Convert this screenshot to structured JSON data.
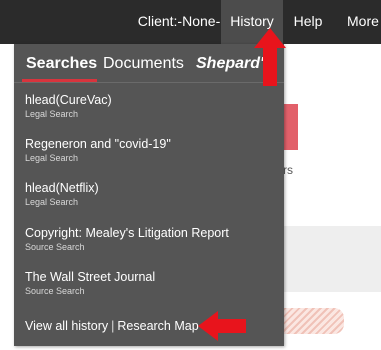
{
  "topnav": {
    "client_label": "Client:-None-",
    "history_label": "History",
    "help_label": "Help",
    "more_label": "More"
  },
  "background": {
    "partial_text": "rs"
  },
  "history_menu": {
    "tabs": [
      {
        "label": "Searches",
        "active": true
      },
      {
        "label": "Documents",
        "active": false
      },
      {
        "label": "Shepard's",
        "active": false
      }
    ],
    "items": [
      {
        "title": "hlead(CureVac)",
        "subtitle": "Legal Search"
      },
      {
        "title": "Regeneron and \"covid-19\"",
        "subtitle": "Legal Search"
      },
      {
        "title": "hlead(Netflix)",
        "subtitle": "Legal Search"
      },
      {
        "title": "Copyright: Mealey's Litigation Report",
        "subtitle": "Source Search"
      },
      {
        "title": "The Wall Street Journal",
        "subtitle": "Source Search"
      }
    ],
    "footer": {
      "view_all": "View all history",
      "separator": "|",
      "research_map": "Research Map"
    }
  },
  "colors": {
    "nav_bg": "#2b2b2b",
    "nav_active_bg": "#4c4c4c",
    "panel_bg": "#555555",
    "tab_underline": "#d8343d",
    "annotation_arrow": "#e8141c"
  },
  "icons": [
    "up-arrow-annotation-icon",
    "left-arrow-annotation-icon"
  ]
}
